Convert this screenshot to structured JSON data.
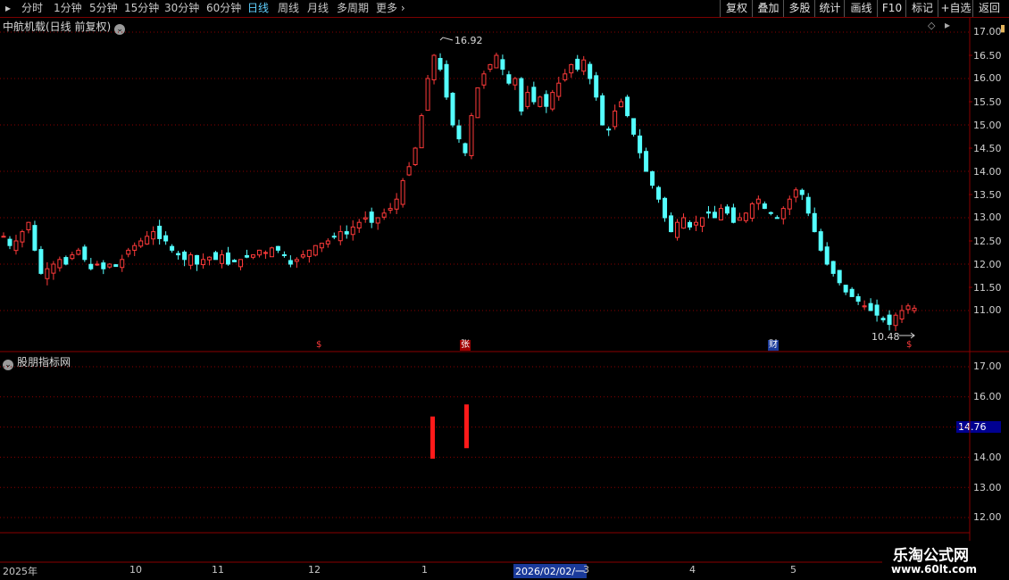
{
  "toolbar": {
    "periods": [
      "分时",
      "1分钟",
      "5分钟",
      "15分钟",
      "30分钟",
      "60分钟",
      "日线",
      "周线",
      "月线",
      "多周期",
      "更多"
    ],
    "active_period": "日线",
    "tools": [
      "复权",
      "叠加",
      "多股",
      "统计",
      "画线",
      "F10",
      "标记",
      "+自选",
      "返回"
    ]
  },
  "main_panel": {
    "title": "中航机载(日线 前复权)",
    "y_ticks": [
      "17.00",
      "16.50",
      "16.00",
      "15.50",
      "15.00",
      "14.50",
      "14.00",
      "13.50",
      "13.00",
      "12.50",
      "12.00",
      "11.50",
      "11.00"
    ],
    "high_label": "16.92",
    "low_label": "10.48",
    "event_marks": [
      "$",
      "张",
      "财",
      "$"
    ]
  },
  "sub_panel": {
    "title": "股朋指标网",
    "y_ticks": [
      "17.00",
      "16.00",
      "15.00",
      "14.00",
      "13.00",
      "12.00"
    ],
    "current_value": "14.76"
  },
  "date_axis": [
    "2025年",
    "10",
    "11",
    "12",
    "1",
    "3",
    "4",
    "5"
  ],
  "cursor_date": "2026/02/02/一",
  "watermark": {
    "title": "乐淘公式网",
    "url": "www.60lt.com"
  },
  "colors": {
    "up": "#ff3a3a",
    "down": "#54ffff",
    "grid": "#8a0000",
    "highlight": "#000090",
    "cursor_bg": "#1a3a9a"
  },
  "chart_data": {
    "type": "candlestick",
    "price_range": [
      10.2,
      17.2
    ],
    "high": 16.92,
    "low": 10.48,
    "closes": [
      12.6,
      12.4,
      12.5,
      12.7,
      12.9,
      12.3,
      11.8,
      11.9,
      12.0,
      12.1,
      12.0,
      12.2,
      12.3,
      12.1,
      11.9,
      12.0,
      11.9,
      12.0,
      11.95,
      12.1,
      12.3,
      12.4,
      12.5,
      12.6,
      12.7,
      12.55,
      12.5,
      12.3,
      12.2,
      12.1,
      12.2,
      12.0,
      12.1,
      12.15,
      12.1,
      12.2,
      12.0,
      12.05,
      12.1,
      12.15,
      12.2,
      12.3,
      12.25,
      12.35,
      12.3,
      12.2,
      12.0,
      12.1,
      12.2,
      12.3,
      12.4,
      12.45,
      12.5,
      12.6,
      12.7,
      12.65,
      12.8,
      12.9,
      13.0,
      12.9,
      13.0,
      13.1,
      13.2,
      13.4,
      13.8,
      14.1,
      14.5,
      15.2,
      16.0,
      16.5,
      16.2,
      15.6,
      15.0,
      14.7,
      14.4,
      15.2,
      15.8,
      16.1,
      16.3,
      16.5,
      16.2,
      15.9,
      16.0,
      15.3,
      15.7,
      15.5,
      15.6,
      15.4,
      15.7,
      15.9,
      16.1,
      16.3,
      16.2,
      16.4,
      16.0,
      15.6,
      15.0,
      14.9,
      15.3,
      15.5,
      15.2,
      14.8,
      14.4,
      14.0,
      13.7,
      13.4,
      13.0,
      12.7,
      12.9,
      13.0,
      12.8,
      12.9,
      13.0,
      13.1,
      13.0,
      13.2,
      13.1,
      12.9,
      13.0,
      13.1,
      13.3,
      13.4,
      13.2,
      13.1,
      13.0,
      13.2,
      13.4,
      13.6,
      13.5,
      13.1,
      12.7,
      12.3,
      12.0,
      11.8,
      11.6,
      11.4,
      11.3,
      11.2,
      11.1,
      11.0,
      10.9,
      10.8,
      10.7,
      10.9,
      11.0,
      11.1,
      11.05
    ],
    "indicator": {
      "type": "bar",
      "bars": [
        {
          "low": 13.95,
          "high": 15.35
        },
        {
          "low": 14.3,
          "high": 15.75
        }
      ],
      "y_range": [
        11.6,
        17.3
      ],
      "current": 14.76
    }
  }
}
